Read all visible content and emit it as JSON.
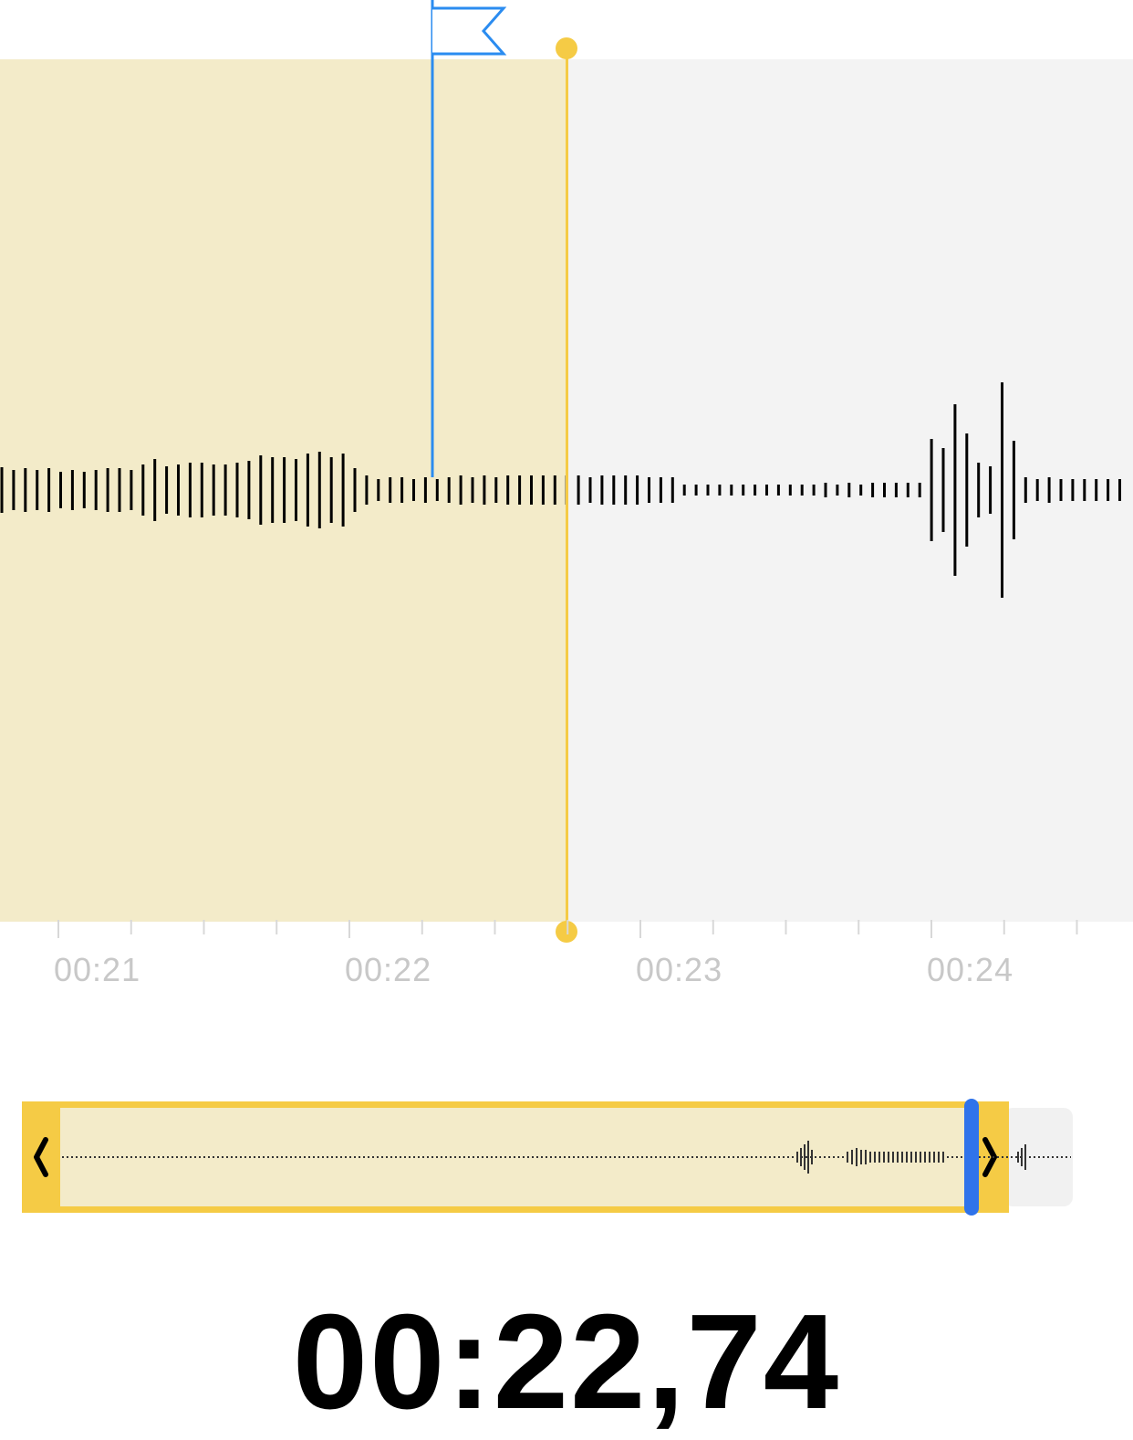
{
  "waveform": {
    "time_labels": [
      "00:21",
      "00:22",
      "00:23",
      "00:24"
    ],
    "colors": {
      "trim_accent": "#f5cb45",
      "trim_shade": "#f3ebc9",
      "flag_marker": "#2b8cf0",
      "playhead_overview": "#2f73ea",
      "background": "#f3f3f3"
    }
  },
  "overview": {
    "left_grip_icon": "chevron-left-icon",
    "right_grip_icon": "chevron-right-icon"
  },
  "current_time": "00:22,74"
}
